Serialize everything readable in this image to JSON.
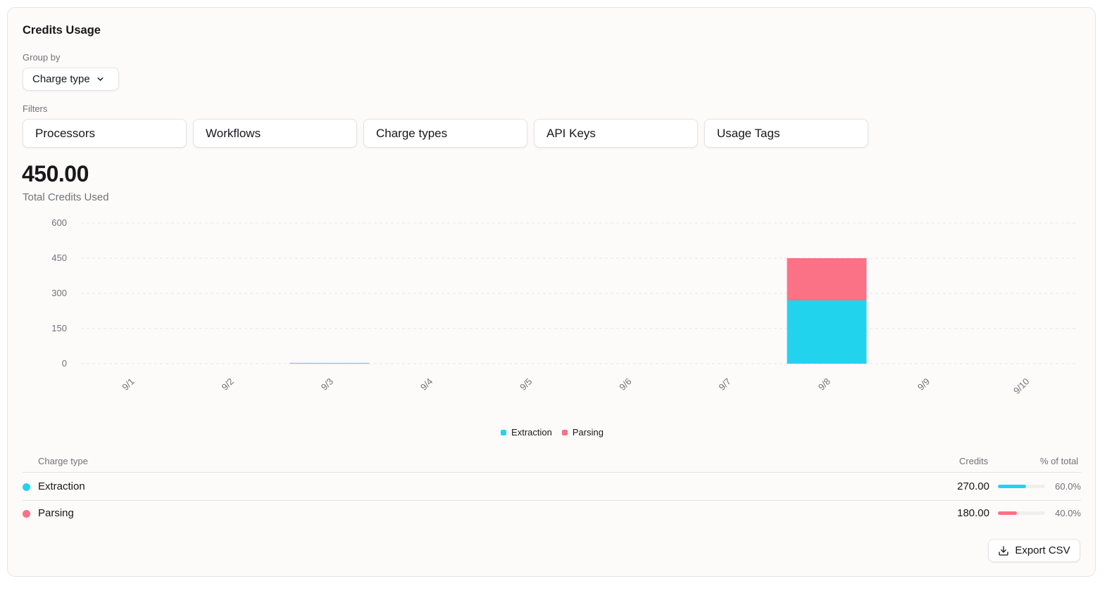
{
  "panel": {
    "title": "Credits Usage",
    "group_by_label": "Group by",
    "group_by_value": "Charge type",
    "filters_label": "Filters",
    "filters": [
      "Processors",
      "Workflows",
      "Charge types",
      "API Keys",
      "Usage Tags"
    ]
  },
  "summary": {
    "total_value": "450.00",
    "total_label": "Total Credits Used"
  },
  "chart_data": {
    "type": "bar",
    "stacked": true,
    "categories": [
      "9/1",
      "9/2",
      "9/3",
      "9/4",
      "9/5",
      "9/6",
      "9/7",
      "9/8",
      "9/9",
      "9/10"
    ],
    "series": [
      {
        "name": "Extraction",
        "color": "#22d3ee",
        "values": [
          0,
          0,
          0,
          0,
          0,
          0,
          0,
          270,
          0,
          0
        ]
      },
      {
        "name": "Parsing",
        "color": "#fb7185",
        "values": [
          0,
          0,
          0,
          0,
          0,
          0,
          0,
          180,
          0,
          0
        ]
      }
    ],
    "yticks": [
      0,
      150,
      300,
      450,
      600
    ],
    "ylim": [
      0,
      600
    ],
    "grid": true,
    "legend_position": "bottom-center",
    "tick_color": "#71717a",
    "grid_color": "#e4e4e7",
    "highlight_color": "#93c5fd"
  },
  "table": {
    "columns": [
      "Charge type",
      "Credits",
      "% of total"
    ],
    "rows": [
      {
        "name": "Extraction",
        "credits": "270.00",
        "percent": "60.0%",
        "fraction": 0.6,
        "color": "#22d3ee"
      },
      {
        "name": "Parsing",
        "credits": "180.00",
        "percent": "40.0%",
        "fraction": 0.4,
        "color": "#fb7185"
      }
    ]
  },
  "actions": {
    "export_label": "Export CSV",
    "export_icon": "download-icon",
    "group_by_icon": "chevron-down-icon"
  }
}
